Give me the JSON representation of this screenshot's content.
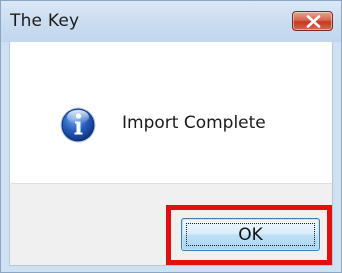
{
  "window": {
    "title": "The Key"
  },
  "dialog": {
    "icon": "info-icon",
    "message": "Import Complete"
  },
  "buttons": {
    "ok_label": "OK"
  },
  "colors": {
    "highlight_border": "#e01010",
    "titlebar": "#cadcf0",
    "close_button": "#c43a1f"
  }
}
